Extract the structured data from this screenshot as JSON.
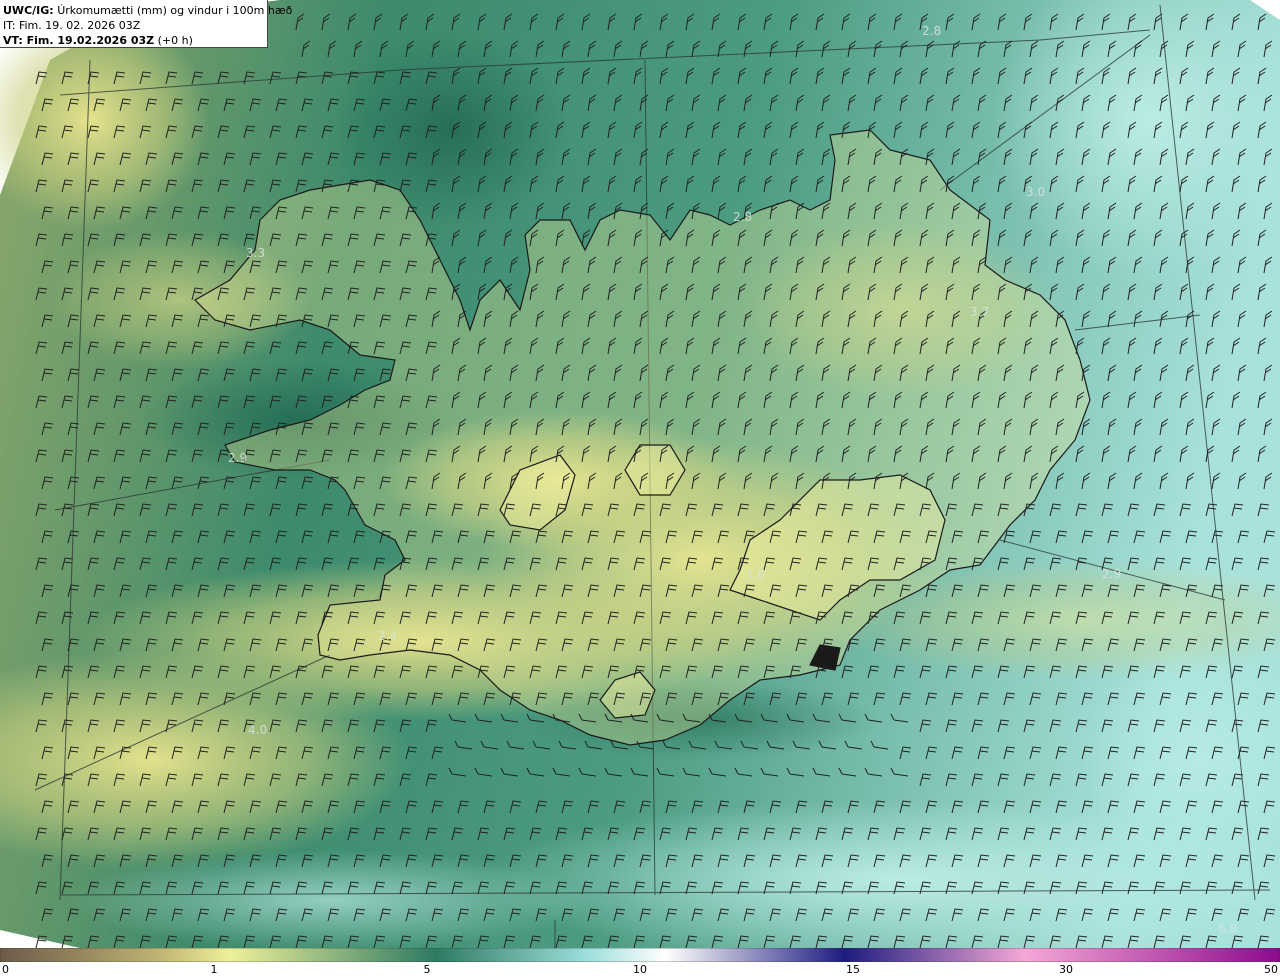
{
  "header": {
    "model": "UWC/IG:",
    "description": "Úrkomumætti (mm) og vindur i 100m hæð",
    "it_line": "IT: Fim. 19. 02. 2026 03Z",
    "vt_label": "VT: Fim. 19.02.2026 03Z",
    "vt_offset": "(+0 h)"
  },
  "colorbar": {
    "ticks": [
      "0",
      "1",
      "5",
      "10",
      "15",
      "30",
      "50"
    ],
    "colors": [
      "#6b5a48",
      "#bdb072",
      "#eef09a",
      "#2e7a62",
      "#9ee0dc",
      "#ffffff",
      "#1c1c7e",
      "#f4a8d6",
      "#8c0a8c"
    ]
  },
  "map_values": [
    "3.3",
    "2.8",
    "3.7",
    "2.9",
    "6.8",
    "4.0",
    "2.9",
    "1.6",
    "2.8",
    "3.0",
    "2.4"
  ],
  "colors": {
    "low_yellow": "#e8e48a",
    "mid_green": "#2f7c64",
    "high_cyan": "#b7e8e2",
    "coast": "#1a1a1a",
    "barb": "#222222"
  }
}
